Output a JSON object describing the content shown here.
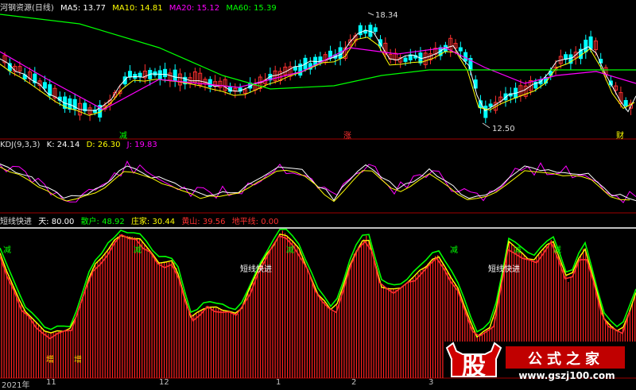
{
  "main_legend": {
    "title": "河钢资源(日线)",
    "ma5": "MA5: 13.77",
    "ma10": "MA10: 14.81",
    "ma20": "MA20: 15.12",
    "ma60": "MA60: 15.39"
  },
  "main_chart": {
    "high_label": "18.34",
    "low_label": "12.50",
    "signals": [
      "减",
      "涨",
      "财"
    ]
  },
  "kdj_legend": {
    "name": "KDJ(9,3,3)",
    "k": "K: 24.14",
    "d": "D: 26.30",
    "j": "J: 19.83"
  },
  "kxj_legend": {
    "name": "短线快进",
    "sky": "天: 80.00",
    "retail": "散户: 48.92",
    "dealer": "庄家: 30.44",
    "golden": "黄山: 39.56",
    "ground": "地平线: 0.00"
  },
  "indicator_labels": {
    "left": "短线快进",
    "right": "短线快进",
    "marks": [
      "减",
      "减",
      "减",
      "减",
      "减",
      "减"
    ],
    "add_marks": [
      "增",
      "增"
    ]
  },
  "time_axis": [
    "2021年",
    "11",
    "12",
    "1",
    "2",
    "3"
  ],
  "watermark": {
    "logo_char": "股",
    "brand": "公式之家",
    "url": "www.gszj100.com"
  },
  "colors": {
    "ma5": "#ffffff",
    "ma10": "#ffff00",
    "ma20": "#ff00ff",
    "ma60": "#00ff00",
    "up": "#ff3030",
    "down": "#00ffff",
    "kxj_bar": "#ff2020"
  }
}
